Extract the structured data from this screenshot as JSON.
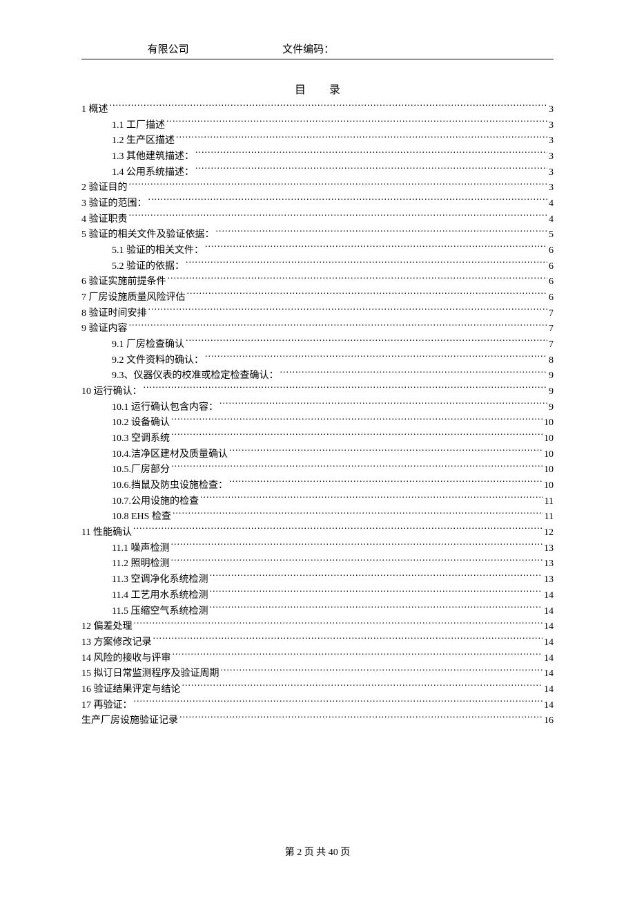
{
  "header": {
    "left": "有限公司",
    "right": "文件编码："
  },
  "toc_title": "目录",
  "toc": [
    {
      "indent": 0,
      "label": "1 概述",
      "page": "3"
    },
    {
      "indent": 1,
      "label": "1.1 工厂描述",
      "page": "3"
    },
    {
      "indent": 1,
      "label": "1.2 生产区描述",
      "page": "3"
    },
    {
      "indent": 1,
      "label": "1.3 其他建筑描述：",
      "page": "3"
    },
    {
      "indent": 1,
      "label": "1.4 公用系统描述：",
      "page": "3"
    },
    {
      "indent": 0,
      "label": "2 验证目的",
      "page": "3"
    },
    {
      "indent": 0,
      "label": "3 验证的范围：",
      "page": "4"
    },
    {
      "indent": 0,
      "label": "4 验证职责",
      "page": "4"
    },
    {
      "indent": 0,
      "label": "5 验证的相关文件及验证依据：",
      "page": "5"
    },
    {
      "indent": 1,
      "label": "5.1  验证的相关文件：",
      "page": "6"
    },
    {
      "indent": 1,
      "label": "5.2  验证的依据：",
      "page": "6"
    },
    {
      "indent": 0,
      "label": "6 验证实施前提条件",
      "page": "6"
    },
    {
      "indent": 0,
      "label": "7 厂房设施质量风险评估",
      "page": "6"
    },
    {
      "indent": 0,
      "label": "8 验证时间安排",
      "page": "7"
    },
    {
      "indent": 0,
      "label": "9 验证内容",
      "page": "7"
    },
    {
      "indent": 1,
      "label": "9.1 厂房检查确认",
      "page": "7"
    },
    {
      "indent": 1,
      "label": "9.2  文件资料的确认：",
      "page": "8"
    },
    {
      "indent": 1,
      "label": "9.3、仪器仪表的校准或检定检查确认：",
      "page": "9"
    },
    {
      "indent": 0,
      "label": "10 运行确认：",
      "page": "9"
    },
    {
      "indent": 1,
      "label": "10.1 运行确认包含内容：",
      "page": "9"
    },
    {
      "indent": 1,
      "label": "10.2  设备确认",
      "page": "10"
    },
    {
      "indent": 1,
      "label": "10.3 空调系统",
      "page": "10"
    },
    {
      "indent": 1,
      "label": "10.4.洁净区建材及质量确认",
      "page": "10"
    },
    {
      "indent": 1,
      "label": "10.5.厂房部分",
      "page": "10"
    },
    {
      "indent": 1,
      "label": "10.6.挡鼠及防虫设施检查：",
      "page": "10"
    },
    {
      "indent": 1,
      "label": "10.7.公用设施的检查",
      "page": "11"
    },
    {
      "indent": 1,
      "label": "10.8 EHS 检查",
      "page": "11"
    },
    {
      "indent": 0,
      "label": "11 性能确认",
      "page": "12"
    },
    {
      "indent": 1,
      "label": "11.1 噪声检测",
      "page": "13"
    },
    {
      "indent": 1,
      "label": "11.2 照明检测",
      "page": "13"
    },
    {
      "indent": 1,
      "label": "11.3  空调净化系统检测",
      "page": "13"
    },
    {
      "indent": 1,
      "label": "11.4  工艺用水系统检测",
      "page": "14"
    },
    {
      "indent": 1,
      "label": "11.5  压缩空气系统检测",
      "page": "14"
    },
    {
      "indent": 0,
      "label": "12 偏差处理",
      "page": "14"
    },
    {
      "indent": 0,
      "label": "13 方案修改记录",
      "page": "14"
    },
    {
      "indent": 0,
      "label": "14 风险的接收与评审",
      "page": "14"
    },
    {
      "indent": 0,
      "label": "15 拟订日常监测程序及验证周期",
      "page": "14"
    },
    {
      "indent": 0,
      "label": "16 验证结果评定与结论",
      "page": "14"
    },
    {
      "indent": 0,
      "label": "17 再验证：",
      "page": "14"
    },
    {
      "indent": 0,
      "label": "生产厂房设施验证记录",
      "page": "16"
    }
  ],
  "footer": {
    "prefix": "第",
    "current": "2",
    "middle": "页 共",
    "total": "40",
    "suffix": "页"
  }
}
